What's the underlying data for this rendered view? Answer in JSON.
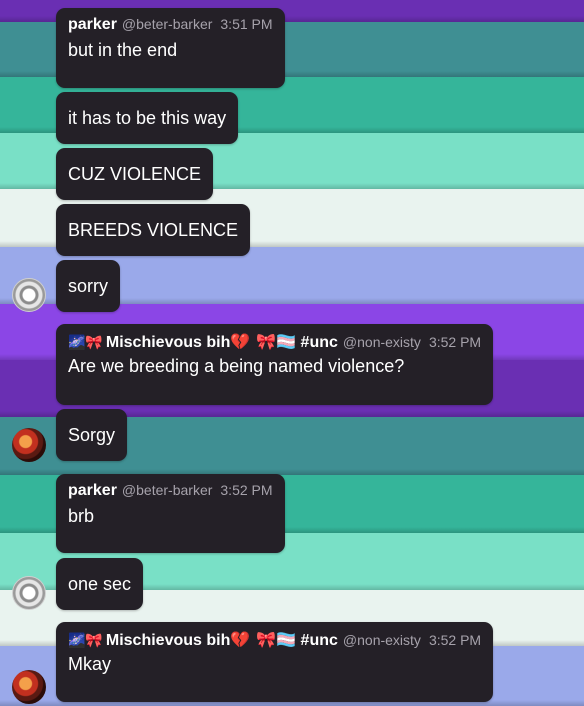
{
  "messages": [
    {
      "name": "parker",
      "handle": "@beter-barker",
      "time": "3:51 PM",
      "text": "but in the end"
    },
    {
      "text": "it has to be this way"
    },
    {
      "text": "CUZ VIOLENCE"
    },
    {
      "text": "BREEDS VIOLENCE"
    },
    {
      "text": "sorry"
    },
    {
      "name_prefix_emoji": "🌌🎀",
      "name": "Mischievous bih💔",
      "name_suffix": "🎀🏳️‍⚧️ #unc",
      "handle": "@non-existy",
      "time": "3:52 PM",
      "text": "Are we breeding a being named violence?"
    },
    {
      "text": "Sorgy"
    },
    {
      "name": "parker",
      "handle": "@beter-barker",
      "time": "3:52 PM",
      "text": "brb"
    },
    {
      "text": "one sec"
    },
    {
      "name_prefix_emoji": "🌌🎀",
      "name": "Mischievous bih💔",
      "name_suffix": "🎀🏳️‍⚧️ #unc",
      "handle": "@non-existy",
      "time": "3:52 PM",
      "text": "Mkay"
    }
  ],
  "avatars": {
    "parker": "gear-avatar",
    "mischievous": "red-character-avatar"
  },
  "colors": {
    "bubble": "#242027",
    "handle_text": "#a6a2ab",
    "stripes": [
      "#6a2fb3",
      "#3f8f93",
      "#35b59a",
      "#79e0c6",
      "#e9f3ef",
      "#9aa9ea",
      "#8b46e6",
      "#6a2fb3",
      "#3f8f93",
      "#35b59a",
      "#79e0c6",
      "#e9f3ef",
      "#9aa9ea"
    ]
  }
}
